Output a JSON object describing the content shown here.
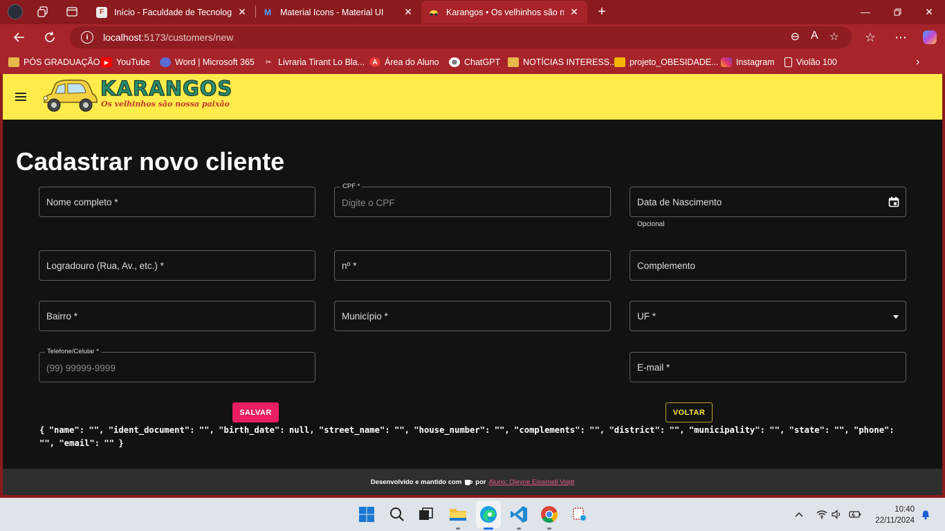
{
  "browser": {
    "tabs": [
      {
        "title": "Início - Faculdade de Tecnologia d",
        "active": false
      },
      {
        "title": "Material Icons - Material UI",
        "active": false
      },
      {
        "title": "Karangos • Os velhinhos são nossa",
        "active": true
      }
    ],
    "url_host": "localhost",
    "url_path": ":5173/customers/new",
    "bookmarks": [
      "PÓS GRADUAÇÃO",
      "YouTube",
      "Word | Microsoft 365",
      "Livraria Tirant Lo Bla...",
      "Área do Aluno",
      "ChatGPT",
      "NOTÍCIAS INTERESS...",
      "projeto_OBESIDADE...",
      "Instagram",
      "Violão 100"
    ]
  },
  "app": {
    "logo_title": "KARANGOS",
    "logo_subtitle": "Os velhinhos são nossa paixão",
    "page_title": "Cadastrar novo cliente",
    "fields": {
      "name": {
        "label": "Nome completo *"
      },
      "cpf": {
        "label": "CPF *",
        "placeholder": "Digite o CPF"
      },
      "birth_date": {
        "label": "Data de Nascimento",
        "helper": "Opcional"
      },
      "street": {
        "label": "Logradouro (Rua, Av., etc.) *"
      },
      "number": {
        "label": "nº *"
      },
      "complement": {
        "label": "Complemento"
      },
      "district": {
        "label": "Bairro *"
      },
      "municipality": {
        "label": "Município *"
      },
      "state": {
        "label": "UF *"
      },
      "phone": {
        "label": "Telefone/Celular *",
        "placeholder": "(99) 99999-9999"
      },
      "email": {
        "label": "E-mail *"
      }
    },
    "save_label": "SALVAR",
    "back_label": "VOLTAR",
    "json_dump": "{ \"name\": \"\", \"ident_document\": \"\", \"birth_date\": null, \"street_name\": \"\", \"house_number\": \"\", \"complements\": \"\", \"district\": \"\", \"municipality\": \"\", \"state\": \"\", \"phone\": \"\", \"email\": \"\" }",
    "footer_text": "Desenvolvido e mantido com",
    "footer_by": "por",
    "footer_link": "Aluno: Ojeyne Eissimell Voigt"
  },
  "taskbar": {
    "time": "10:40",
    "date": "22/11/2024"
  },
  "colors": {
    "browser_frame": "#8b1a1e",
    "appbar": "#ffeb4b",
    "save_button": "#e91e63",
    "back_button": "#ffeb3b"
  }
}
